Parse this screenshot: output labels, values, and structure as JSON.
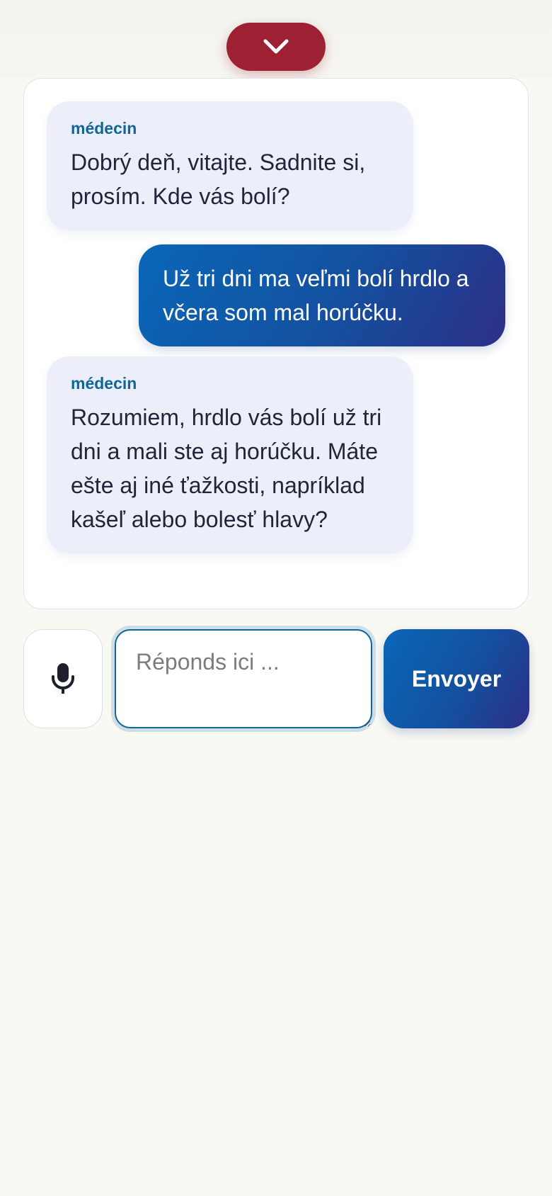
{
  "header": {
    "collapse_icon": "chevron-down-icon",
    "collapse_color": "#9e2033"
  },
  "messages": [
    {
      "role": "bot",
      "sender": "médecin",
      "text": "Dobrý deň, vitajte. Sadnite si, prosím. Kde vás bolí?"
    },
    {
      "role": "user",
      "text": "Už tri dni ma veľmi bolí hrdlo a včera som mal horúčku."
    },
    {
      "role": "bot",
      "sender": "médecin",
      "text": "Rozumiem, hrdlo vás bolí už tri dni a mali ste aj horúčku. Máte ešte aj iné ťažkosti, napríklad kašeľ alebo bolesť hlavy?"
    }
  ],
  "composer": {
    "mic_icon": "microphone-icon",
    "placeholder": "Réponds ici ...",
    "value": "",
    "send_label": "Envoyer"
  },
  "colors": {
    "accent_blue": "#0a67b8",
    "accent_indigo": "#2d2f86",
    "sender_label": "#0e6699",
    "bot_bubble": "#eceff9"
  }
}
